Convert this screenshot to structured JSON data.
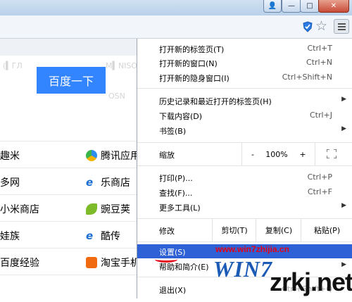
{
  "window_controls": {
    "user": "👤",
    "minimize": "—",
    "maximize": "□",
    "close": "✕"
  },
  "page": {
    "search_button": "百度一下",
    "faint_texts": [
      "(▍ГЛ",
      "Μ▍ΝΙSΟ",
      "OSΝ"
    ],
    "sites": [
      {
        "left": "趣米",
        "right": "腾讯应用"
      },
      {
        "left": "多网",
        "right": "乐商店"
      },
      {
        "left": "小米商店",
        "right": "豌豆荚"
      },
      {
        "left": "娃族",
        "right": "酷传"
      },
      {
        "left": "百度经验",
        "right": "淘宝手机"
      },
      {
        "left": "",
        "right": ""
      }
    ]
  },
  "menu": {
    "group1": [
      {
        "label": "打开新的标签页(T)",
        "shortcut": "Ctrl+T"
      },
      {
        "label": "打开新的窗口(N)",
        "shortcut": "Ctrl+N"
      },
      {
        "label": "打开新的隐身窗口(I)",
        "shortcut": "Ctrl+Shift+N"
      }
    ],
    "group2": [
      {
        "label": "历史记录和最近打开的标签页(H)",
        "shortcut": "",
        "submenu": true
      },
      {
        "label": "下载内容(D)",
        "shortcut": "Ctrl+J",
        "submenu": false
      },
      {
        "label": "书签(B)",
        "shortcut": "",
        "submenu": true
      }
    ],
    "zoom": {
      "label": "缩放",
      "minus": "-",
      "value": "100%",
      "plus": "+"
    },
    "group3": [
      {
        "label": "打印(P)...",
        "shortcut": "Ctrl+P",
        "submenu": false
      },
      {
        "label": "查找(F)...",
        "shortcut": "Ctrl+F",
        "submenu": false
      },
      {
        "label": "更多工具(L)",
        "shortcut": "",
        "submenu": true
      }
    ],
    "edit": {
      "label": "修改",
      "cut": "剪切(T)",
      "copy": "复制(C)",
      "paste": "粘贴(P)"
    },
    "settings": {
      "label": "设置(S)",
      "url_overlay": "www.win7zhijia.cn"
    },
    "help": {
      "label": "帮助和简介(E)"
    },
    "exit": {
      "label": "退出(X)",
      "shortcut": "Ctrl+Shift+Q"
    }
  },
  "watermark": {
    "win": "WIN7",
    "site": "zrkj.net"
  },
  "arrow_glyph": "▶"
}
